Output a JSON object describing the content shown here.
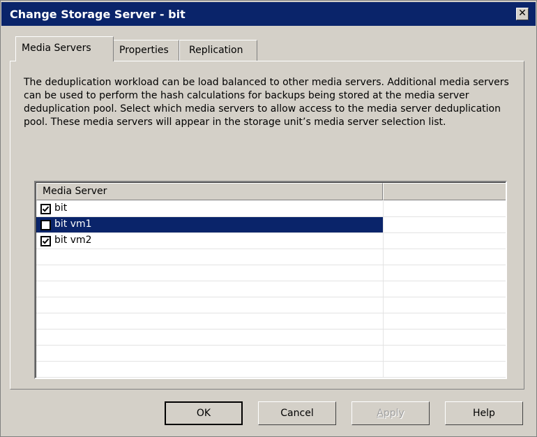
{
  "window": {
    "title": "Change Storage Server - bit",
    "close_glyph": "✕"
  },
  "tabs": [
    {
      "label": "Media Servers",
      "active": true
    },
    {
      "label": "Properties",
      "active": false
    },
    {
      "label": "Replication",
      "active": false
    }
  ],
  "description": "The deduplication workload can be load balanced to other media servers. Additional media servers can be used to perform the hash calculations for backups being stored at the media server deduplication pool. Select which media servers to allow access to the media server deduplication pool.  These media servers will appear in the storage unit’s media server selection list.",
  "list": {
    "columns": [
      "Media Server",
      ""
    ],
    "rows": [
      {
        "label": "bit",
        "checked": true,
        "selected": false
      },
      {
        "label": "bit vm1",
        "checked": false,
        "selected": true
      },
      {
        "label": "bit vm2",
        "checked": true,
        "selected": false
      }
    ]
  },
  "buttons": {
    "ok": "OK",
    "cancel": "Cancel",
    "apply_first": "A",
    "apply_rest": "pply",
    "help": "Help"
  },
  "colors": {
    "titlebar": "#0a246a",
    "selection": "#0a246a",
    "face": "#d4d0c8"
  }
}
